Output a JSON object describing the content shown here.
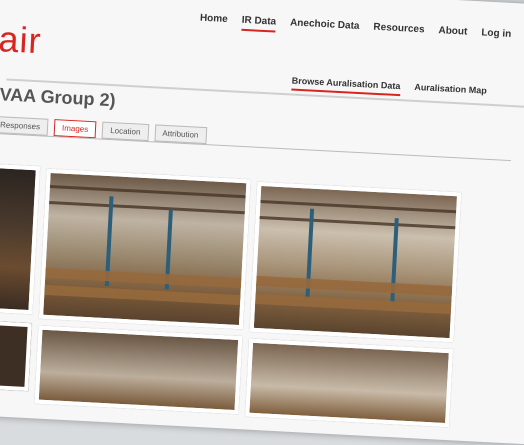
{
  "brand": {
    "logo_text": "air"
  },
  "top_nav": [
    {
      "label": "Home",
      "active": false
    },
    {
      "label": "IR Data",
      "active": true
    },
    {
      "label": "Anechoic Data",
      "active": false
    },
    {
      "label": "Resources",
      "active": false
    },
    {
      "label": "About",
      "active": false
    },
    {
      "label": "Log in",
      "active": false
    }
  ],
  "sub_nav": [
    {
      "label": "Browse Auralisation Data",
      "active": true
    },
    {
      "label": "Auralisation Map",
      "active": false
    }
  ],
  "page": {
    "title": "(VAA Group 2)"
  },
  "tabs": [
    {
      "label": "Responses",
      "active": false
    },
    {
      "label": "Images",
      "active": true
    },
    {
      "label": "Location",
      "active": false
    },
    {
      "label": "Attribution",
      "active": false
    }
  ],
  "colors": {
    "accent": "#d7261f"
  }
}
